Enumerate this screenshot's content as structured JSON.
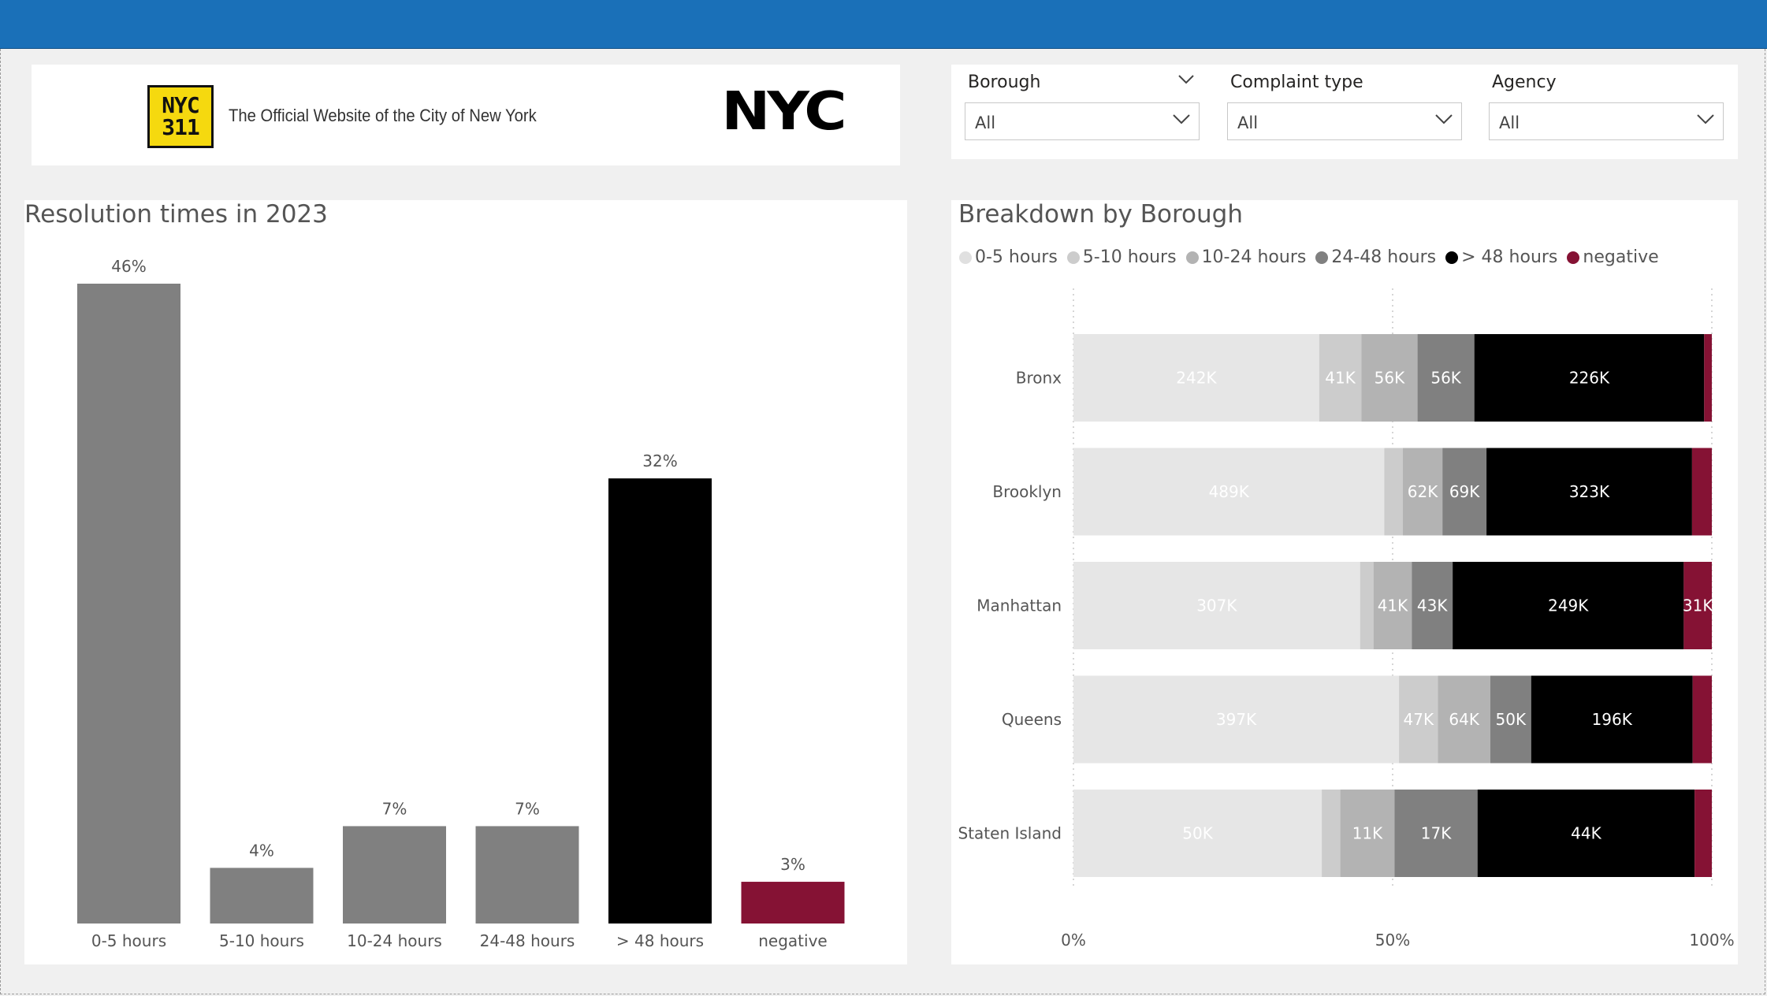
{
  "header": {
    "logo_311_line1": "NYC",
    "logo_311_line2": "311",
    "tagline": "The Official Website of the City of New York",
    "nyc_logo_text": "NYC"
  },
  "filters": [
    {
      "label": "Borough",
      "value": "All"
    },
    {
      "label": "Complaint type",
      "value": "All"
    },
    {
      "label": "Agency",
      "value": "All"
    }
  ],
  "colors": {
    "bar_gray": "#808080",
    "bar_black": "#000000",
    "negative": "#851234",
    "seg_0_5": "#e6e6e6",
    "seg_5_10": "#cccccc",
    "seg_10_24": "#b3b3b3",
    "seg_24_48": "#808080",
    "seg_48": "#000000"
  },
  "chart_data": [
    {
      "type": "bar",
      "title": "Resolution times in 2023",
      "categories": [
        "0-5 hours",
        "5-10 hours",
        "10-24 hours",
        "24-48 hours",
        "> 48 hours",
        "negative"
      ],
      "values": [
        46,
        4,
        7,
        7,
        32,
        3
      ],
      "data_labels": [
        "46%",
        "4%",
        "7%",
        "7%",
        "32%",
        "3%"
      ],
      "bar_colors": [
        "#808080",
        "#808080",
        "#808080",
        "#808080",
        "#000000",
        "#851234"
      ],
      "ylim": [
        0,
        46
      ],
      "grid": false
    },
    {
      "type": "bar",
      "orientation": "horizontal-stacked-100",
      "title": "Breakdown by Borough",
      "categories": [
        "Bronx",
        "Brooklyn",
        "Manhattan",
        "Queens",
        "Staten Island"
      ],
      "legend_position": "top-left",
      "x_ticks": [
        "0%",
        "50%",
        "100%"
      ],
      "xlim": [
        0,
        100
      ],
      "series": [
        {
          "name": "0-5 hours",
          "color": "#e6e6e6",
          "label_color": "#ffffff",
          "percent": [
            38.5,
            48.7,
            44.9,
            51.0,
            38.9
          ],
          "labels": [
            "242K",
            "489K",
            "307K",
            "397K",
            "50K"
          ]
        },
        {
          "name": "5-10 hours",
          "color": "#cccccc",
          "label_color": "#ffffff",
          "percent": [
            6.6,
            2.9,
            2.1,
            6.1,
            2.9
          ],
          "labels": [
            "41K",
            "",
            "",
            "47K",
            ""
          ]
        },
        {
          "name": "10-24 hours",
          "color": "#b3b3b3",
          "label_color": "#ffffff",
          "percent": [
            8.8,
            6.2,
            6.0,
            8.2,
            8.5
          ],
          "labels": [
            "56K",
            "62K",
            "41K",
            "64K",
            "11K"
          ]
        },
        {
          "name": "24-48 hours",
          "color": "#808080",
          "label_color": "#ffffff",
          "percent": [
            8.9,
            6.9,
            6.4,
            6.4,
            13.0
          ],
          "labels": [
            "56K",
            "69K",
            "43K",
            "50K",
            "17K"
          ]
        },
        {
          "name": "> 48 hours",
          "color": "#000000",
          "label_color": "#ffffff",
          "percent": [
            36.0,
            32.2,
            36.2,
            25.3,
            34.0
          ],
          "labels": [
            "226K",
            "323K",
            "249K",
            "196K",
            "44K"
          ]
        },
        {
          "name": "negative",
          "color": "#851234",
          "label_color": "#ffffff",
          "percent": [
            1.2,
            3.1,
            4.4,
            3.0,
            2.7
          ],
          "labels": [
            "",
            "",
            "31K",
            "",
            ""
          ]
        }
      ]
    }
  ]
}
